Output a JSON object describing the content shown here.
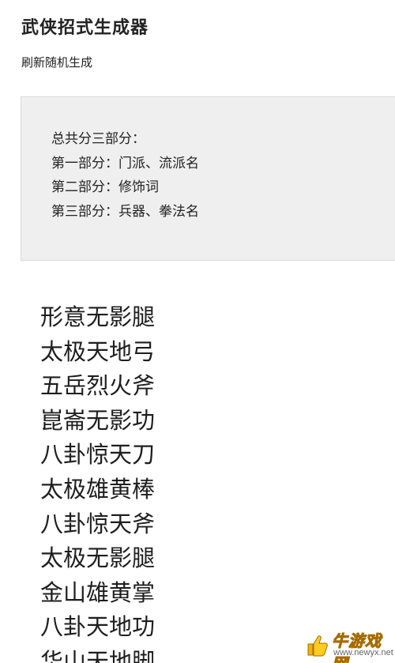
{
  "header": {
    "title": "武侠招式生成器",
    "refresh_label": "刷新随机生成"
  },
  "info": {
    "lines": [
      "总共分三部分：",
      "第一部分：门派、流派名",
      "第二部分：修饰词",
      "第三部分：兵器、拳法名"
    ]
  },
  "results": [
    "形意无影腿",
    "太极天地弓",
    "五岳烈火斧",
    "崑崙无影功",
    "八卦惊天刀",
    "太极雄黄棒",
    "八卦惊天斧",
    "太极无影腿",
    "金山雄黄掌",
    "八卦天地功",
    "华山天地脚"
  ],
  "watermark": {
    "name": "牛游戏网",
    "url": "www.newyx.net"
  }
}
